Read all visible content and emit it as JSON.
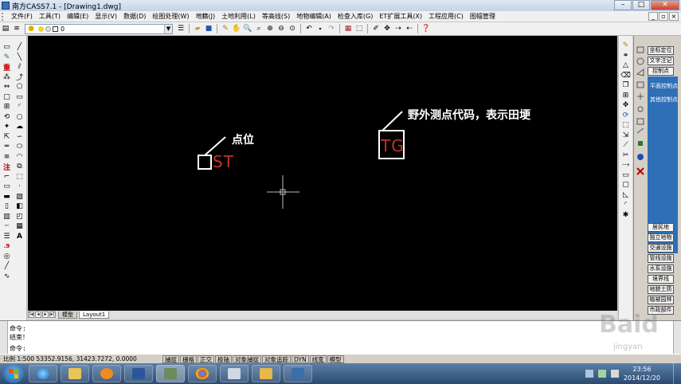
{
  "window": {
    "title": "南方CASS7.1 - [Drawing1.dwg]"
  },
  "menu": [
    "文件(F)",
    "工具(T)",
    "编辑(E)",
    "显示(V)",
    "数据(D)",
    "绘图处理(W)",
    "地籍(J)",
    "土地利用(L)",
    "等高线(S)",
    "地物编辑(A)",
    "检查入库(G)",
    "ET扩展工具(X)",
    "工程应用(C)",
    "图幅管理"
  ],
  "toolbar": {
    "layer_value": "0"
  },
  "canvas": {
    "annotation_point": "点位",
    "annotation_code": "野外测点代码，表示田埂",
    "code_st": "ST",
    "code_tg": "TG"
  },
  "left_toolbar": {
    "text_tool": "A",
    "note_tool": "注",
    "heavy_tool": "重",
    "dot_tool": ".9"
  },
  "sheet_tabs": [
    "模型",
    "Layout1"
  ],
  "right_panel": {
    "top_buttons": [
      "坐标定位",
      "文字注记",
      "控制点"
    ],
    "blue_items": [
      "平面控制点",
      "其他控制点"
    ],
    "bottom_buttons": [
      "居民地",
      "独立地物",
      "交通设施",
      "管线设施",
      "水系设施",
      "境界线",
      "地貌土质",
      "植被园林",
      "市政部件"
    ]
  },
  "command": {
    "lines": [
      "命令:",
      "结束！",
      "命令:"
    ]
  },
  "status": {
    "text": "比例  1:500  53352.9156,  31423.7272,  0.0000",
    "buttons": [
      "捕捉",
      "栅格",
      "正交",
      "极轴",
      "对象捕捉",
      "对象追踪",
      "DYN",
      "线宽",
      "模型"
    ]
  },
  "clock": {
    "time": "23:56",
    "date": "2014/12/20"
  },
  "watermark": {
    "brand": "Baid",
    "site": "jingyan"
  },
  "colors": {
    "canvas": "#000000",
    "code_text": "#c4312a",
    "panel_blue": "#2e6fb7"
  }
}
